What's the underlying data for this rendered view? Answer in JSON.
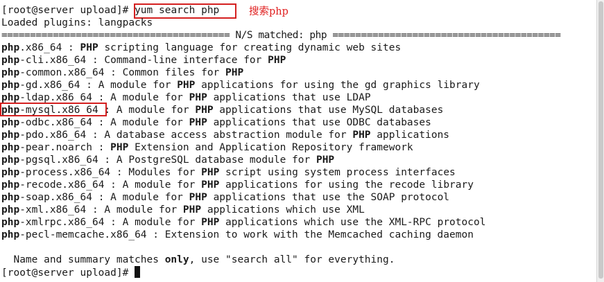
{
  "terminal": {
    "prompt": "[root@server upload]#",
    "command": "yum search php",
    "annotation": "搜索php",
    "plugins_line": "Loaded plugins: langpacks",
    "matched_header": "======================================== N/S matched: php ========================================",
    "results": [
      {
        "pkg": "php",
        "desc": ".x86_64 : ",
        "b": "PHP",
        "rest": " scripting language for creating dynamic web sites"
      },
      {
        "pkg": "php",
        "desc": "-cli.x86_64 : Command-line interface for ",
        "b": "PHP",
        "rest": ""
      },
      {
        "pkg": "php",
        "desc": "-common.x86_64 : Common files for ",
        "b": "PHP",
        "rest": ""
      },
      {
        "pkg": "php",
        "desc": "-gd.x86_64 : A module for ",
        "b": "PHP",
        "rest": " applications for using the gd graphics library"
      },
      {
        "pkg": "php",
        "desc": "-ldap.x86_64 : A module for ",
        "b": "PHP",
        "rest": " applications that use LDAP"
      },
      {
        "pkg": "php",
        "desc": "-mysql.x86_64 : A module for ",
        "b": "PHP",
        "rest": " applications that use MySQL databases"
      },
      {
        "pkg": "php",
        "desc": "-odbc.x86_64 : A module for ",
        "b": "PHP",
        "rest": " applications that use ODBC databases"
      },
      {
        "pkg": "php",
        "desc": "-pdo.x86_64 : A database access abstraction module for ",
        "b": "PHP",
        "rest": " applications"
      },
      {
        "pkg": "php",
        "desc": "-pear.noarch : ",
        "b": "PHP",
        "rest": " Extension and Application Repository framework"
      },
      {
        "pkg": "php",
        "desc": "-pgsql.x86_64 : A PostgreSQL database module for ",
        "b": "PHP",
        "rest": ""
      },
      {
        "pkg": "php",
        "desc": "-process.x86_64 : Modules for ",
        "b": "PHP",
        "rest": " script using system process interfaces"
      },
      {
        "pkg": "php",
        "desc": "-recode.x86_64 : A module for ",
        "b": "PHP",
        "rest": " applications for using the recode library"
      },
      {
        "pkg": "php",
        "desc": "-soap.x86_64 : A module for ",
        "b": "PHP",
        "rest": " applications that use the SOAP protocol"
      },
      {
        "pkg": "php",
        "desc": "-xml.x86_64 : A module for ",
        "b": "PHP",
        "rest": " applications which use XML"
      },
      {
        "pkg": "php",
        "desc": "-xmlrpc.x86_64 : A module for ",
        "b": "PHP",
        "rest": " applications which use the XML-RPC protocol"
      },
      {
        "pkg": "php",
        "desc": "-pecl-memcache.x86_64 : Extension to work with the Memcached caching daemon",
        "b": "",
        "rest": ""
      }
    ],
    "summary_pre": "  Name and summary matches ",
    "summary_bold": "only",
    "summary_post": ", use \"search all\" for everything.",
    "final_prompt": "[root@server upload]#"
  },
  "colors": {
    "background": "#ffffff",
    "text": "#1a1a1a",
    "annotation": "#e02020"
  }
}
